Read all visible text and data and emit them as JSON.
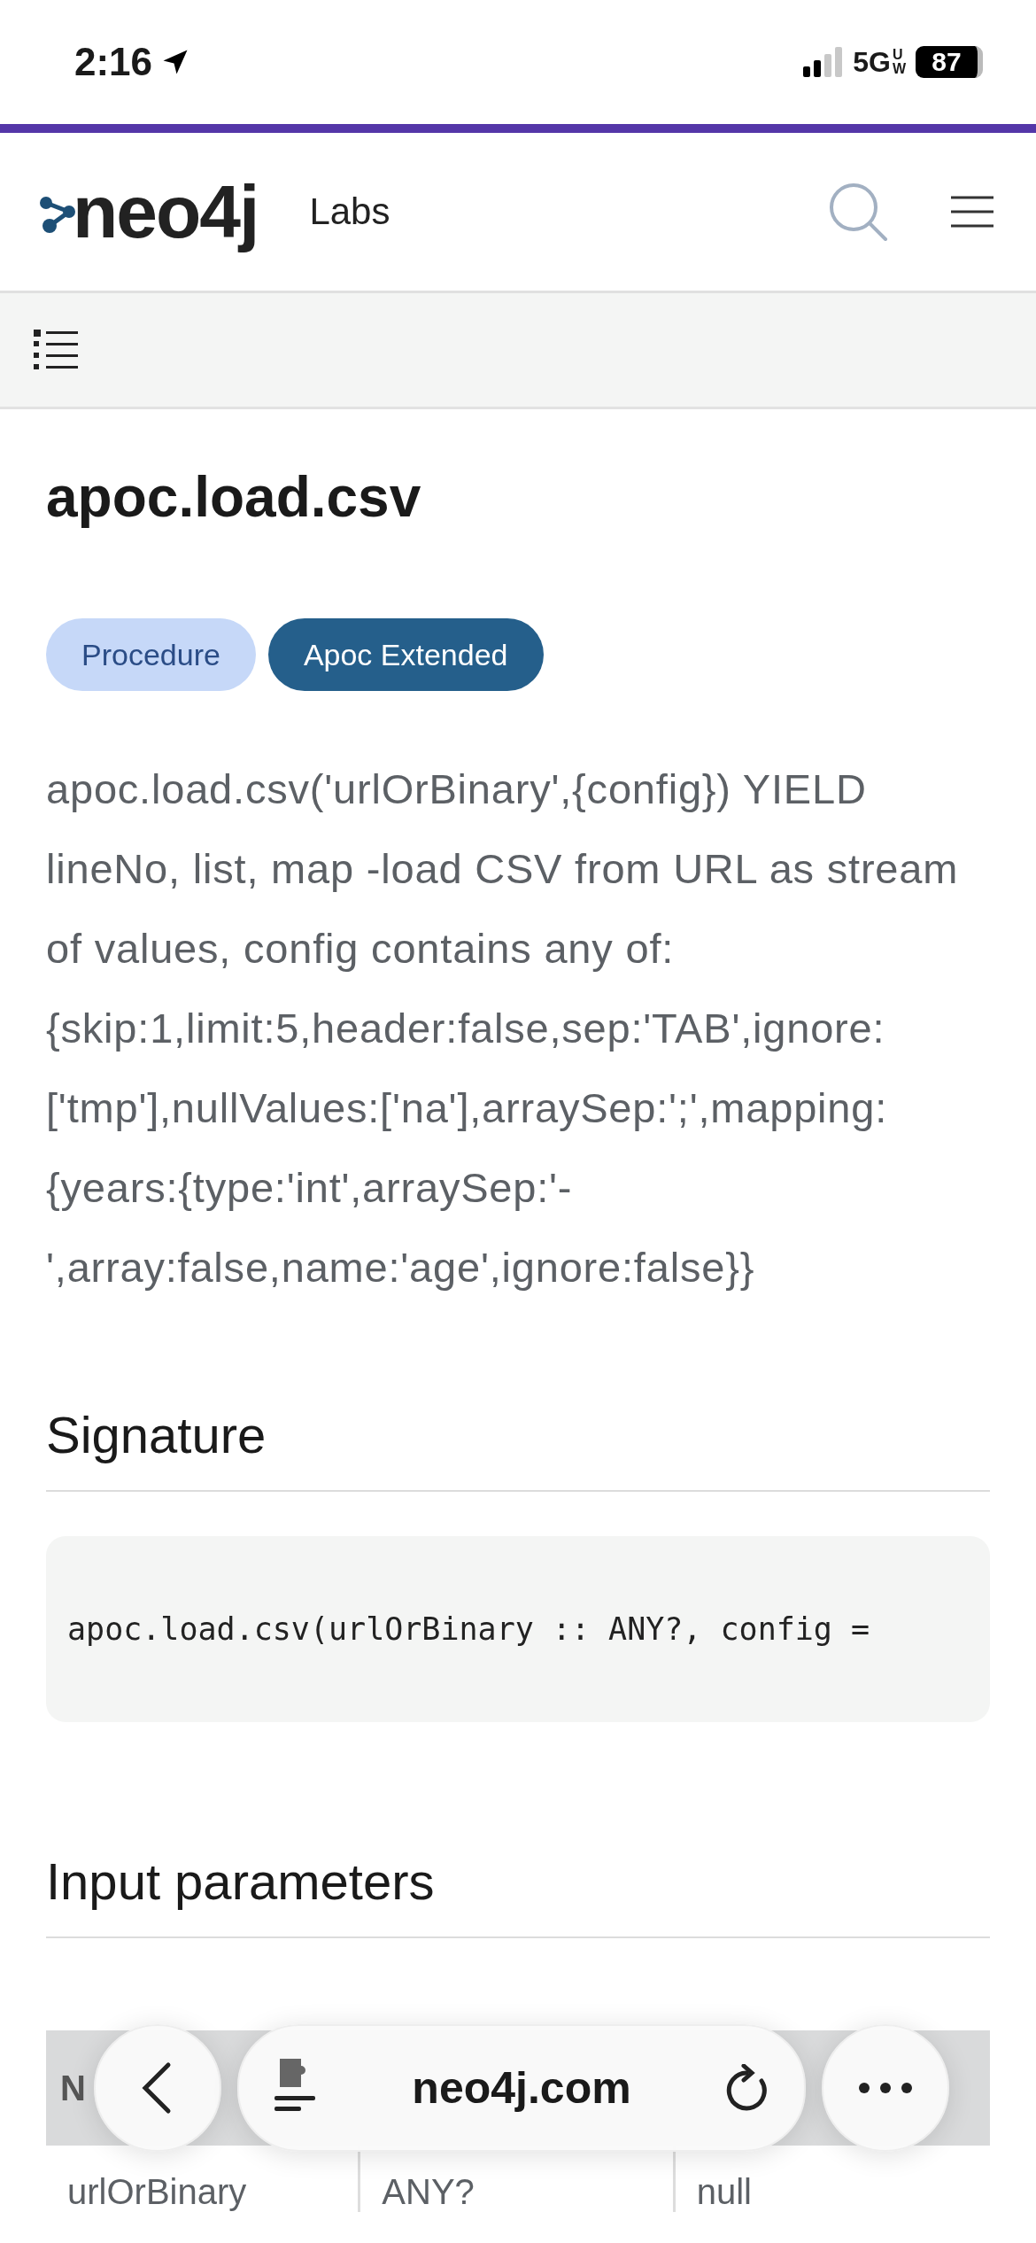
{
  "status_bar": {
    "time": "2:16",
    "network": "5G",
    "network_suffix": "UW",
    "battery": "87"
  },
  "header": {
    "brand": "neo4j",
    "section": "Labs"
  },
  "page": {
    "title": "apoc.load.csv",
    "badges": [
      {
        "label": "Procedure",
        "kind": "light"
      },
      {
        "label": "Apoc Extended",
        "kind": "dark"
      }
    ],
    "description": "apoc.load.csv('urlOrBinary',{config}) YIELD lineNo, list, map -load CSV from URL as stream of values, config contains any of: {skip:1,limit:5,header:false,sep:'TAB',ignore:['tmp'],nullValues:['na'],arraySep:';',mapping:{years:{type:'int',arraySep:'-',array:false,name:'age',ignore:false}}",
    "signature": {
      "heading": "Signature",
      "code": "apoc.load.csv(urlOrBinary :: ANY?, config ="
    },
    "input_parameters": {
      "heading": "Input parameters",
      "columns": [
        "N"
      ],
      "rows": [
        [
          "urlOrBinary",
          "ANY?",
          "null"
        ]
      ]
    }
  },
  "browser_toolbar": {
    "url": "neo4j.com"
  }
}
